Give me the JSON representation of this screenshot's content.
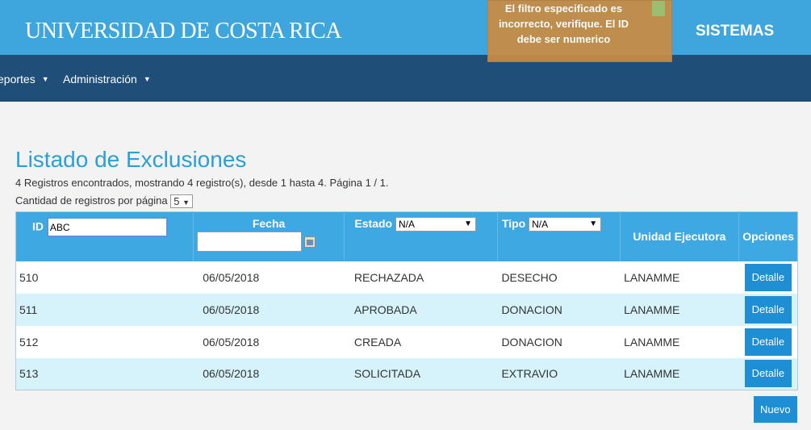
{
  "header": {
    "brand": "UNIVERSIDAD DE COSTA RICA",
    "system": "SISTEMAS",
    "toast": "El filtro especificado es incorrecto, verifique. El ID debe ser numerico"
  },
  "nav": {
    "items": [
      {
        "label": "eportes"
      },
      {
        "label": "Administración"
      }
    ]
  },
  "page": {
    "title": "Listado de Exclusiones",
    "summary": "4 Registros encontrados, mostrando 4 registro(s), desde 1 hasta 4. Página 1 / 1.",
    "per_page_label": "Cantidad de registros por página",
    "per_page_value": "5"
  },
  "table": {
    "headers": {
      "id": "ID",
      "fecha": "Fecha",
      "estado": "Estado",
      "tipo": "Tipo",
      "unidad": "Unidad Ejecutora",
      "opciones": "Opciones"
    },
    "filters": {
      "id_value": "ABC",
      "fecha_value": "",
      "estado_value": "N/A",
      "tipo_value": "N/A"
    },
    "rows": [
      {
        "id": "510",
        "fecha": "06/05/2018",
        "estado": "RECHAZADA",
        "tipo": "DESECHO",
        "unidad": "LANAMME",
        "action": "Detalle"
      },
      {
        "id": "511",
        "fecha": "06/05/2018",
        "estado": "APROBADA",
        "tipo": "DONACION",
        "unidad": "LANAMME",
        "action": "Detalle"
      },
      {
        "id": "512",
        "fecha": "06/05/2018",
        "estado": "CREADA",
        "tipo": "DONACION",
        "unidad": "LANAMME",
        "action": "Detalle"
      },
      {
        "id": "513",
        "fecha": "06/05/2018",
        "estado": "SOLICITADA",
        "tipo": "EXTRAVIO",
        "unidad": "LANAMME",
        "action": "Detalle"
      }
    ]
  },
  "actions": {
    "new_label": "Nuevo"
  },
  "colors": {
    "brand_blue": "#3fa5dd",
    "nav_navy": "#1f4e78",
    "toast_orange": "#c68c45",
    "button_blue": "#1e8fd5"
  }
}
